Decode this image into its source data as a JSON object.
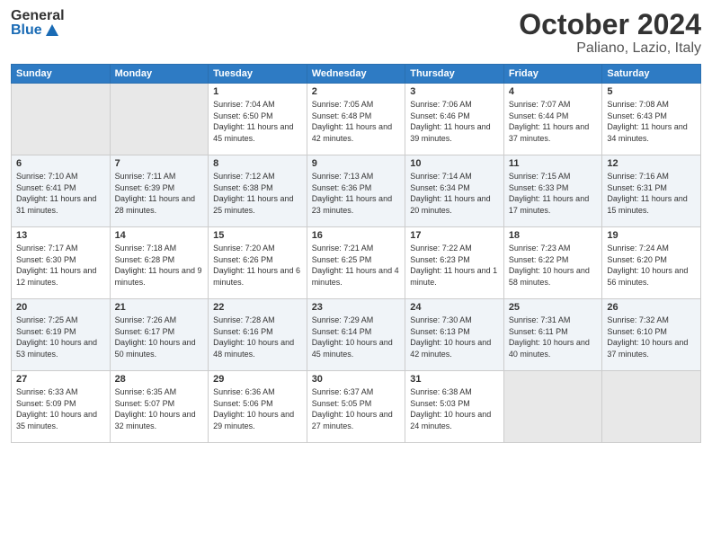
{
  "header": {
    "logo_general": "General",
    "logo_blue": "Blue",
    "month": "October 2024",
    "location": "Paliano, Lazio, Italy"
  },
  "weekdays": [
    "Sunday",
    "Monday",
    "Tuesday",
    "Wednesday",
    "Thursday",
    "Friday",
    "Saturday"
  ],
  "weeks": [
    [
      {
        "day": "",
        "sunrise": "",
        "sunset": "",
        "daylight": ""
      },
      {
        "day": "",
        "sunrise": "",
        "sunset": "",
        "daylight": ""
      },
      {
        "day": "1",
        "sunrise": "Sunrise: 7:04 AM",
        "sunset": "Sunset: 6:50 PM",
        "daylight": "Daylight: 11 hours and 45 minutes."
      },
      {
        "day": "2",
        "sunrise": "Sunrise: 7:05 AM",
        "sunset": "Sunset: 6:48 PM",
        "daylight": "Daylight: 11 hours and 42 minutes."
      },
      {
        "day": "3",
        "sunrise": "Sunrise: 7:06 AM",
        "sunset": "Sunset: 6:46 PM",
        "daylight": "Daylight: 11 hours and 39 minutes."
      },
      {
        "day": "4",
        "sunrise": "Sunrise: 7:07 AM",
        "sunset": "Sunset: 6:44 PM",
        "daylight": "Daylight: 11 hours and 37 minutes."
      },
      {
        "day": "5",
        "sunrise": "Sunrise: 7:08 AM",
        "sunset": "Sunset: 6:43 PM",
        "daylight": "Daylight: 11 hours and 34 minutes."
      }
    ],
    [
      {
        "day": "6",
        "sunrise": "Sunrise: 7:10 AM",
        "sunset": "Sunset: 6:41 PM",
        "daylight": "Daylight: 11 hours and 31 minutes."
      },
      {
        "day": "7",
        "sunrise": "Sunrise: 7:11 AM",
        "sunset": "Sunset: 6:39 PM",
        "daylight": "Daylight: 11 hours and 28 minutes."
      },
      {
        "day": "8",
        "sunrise": "Sunrise: 7:12 AM",
        "sunset": "Sunset: 6:38 PM",
        "daylight": "Daylight: 11 hours and 25 minutes."
      },
      {
        "day": "9",
        "sunrise": "Sunrise: 7:13 AM",
        "sunset": "Sunset: 6:36 PM",
        "daylight": "Daylight: 11 hours and 23 minutes."
      },
      {
        "day": "10",
        "sunrise": "Sunrise: 7:14 AM",
        "sunset": "Sunset: 6:34 PM",
        "daylight": "Daylight: 11 hours and 20 minutes."
      },
      {
        "day": "11",
        "sunrise": "Sunrise: 7:15 AM",
        "sunset": "Sunset: 6:33 PM",
        "daylight": "Daylight: 11 hours and 17 minutes."
      },
      {
        "day": "12",
        "sunrise": "Sunrise: 7:16 AM",
        "sunset": "Sunset: 6:31 PM",
        "daylight": "Daylight: 11 hours and 15 minutes."
      }
    ],
    [
      {
        "day": "13",
        "sunrise": "Sunrise: 7:17 AM",
        "sunset": "Sunset: 6:30 PM",
        "daylight": "Daylight: 11 hours and 12 minutes."
      },
      {
        "day": "14",
        "sunrise": "Sunrise: 7:18 AM",
        "sunset": "Sunset: 6:28 PM",
        "daylight": "Daylight: 11 hours and 9 minutes."
      },
      {
        "day": "15",
        "sunrise": "Sunrise: 7:20 AM",
        "sunset": "Sunset: 6:26 PM",
        "daylight": "Daylight: 11 hours and 6 minutes."
      },
      {
        "day": "16",
        "sunrise": "Sunrise: 7:21 AM",
        "sunset": "Sunset: 6:25 PM",
        "daylight": "Daylight: 11 hours and 4 minutes."
      },
      {
        "day": "17",
        "sunrise": "Sunrise: 7:22 AM",
        "sunset": "Sunset: 6:23 PM",
        "daylight": "Daylight: 11 hours and 1 minute."
      },
      {
        "day": "18",
        "sunrise": "Sunrise: 7:23 AM",
        "sunset": "Sunset: 6:22 PM",
        "daylight": "Daylight: 10 hours and 58 minutes."
      },
      {
        "day": "19",
        "sunrise": "Sunrise: 7:24 AM",
        "sunset": "Sunset: 6:20 PM",
        "daylight": "Daylight: 10 hours and 56 minutes."
      }
    ],
    [
      {
        "day": "20",
        "sunrise": "Sunrise: 7:25 AM",
        "sunset": "Sunset: 6:19 PM",
        "daylight": "Daylight: 10 hours and 53 minutes."
      },
      {
        "day": "21",
        "sunrise": "Sunrise: 7:26 AM",
        "sunset": "Sunset: 6:17 PM",
        "daylight": "Daylight: 10 hours and 50 minutes."
      },
      {
        "day": "22",
        "sunrise": "Sunrise: 7:28 AM",
        "sunset": "Sunset: 6:16 PM",
        "daylight": "Daylight: 10 hours and 48 minutes."
      },
      {
        "day": "23",
        "sunrise": "Sunrise: 7:29 AM",
        "sunset": "Sunset: 6:14 PM",
        "daylight": "Daylight: 10 hours and 45 minutes."
      },
      {
        "day": "24",
        "sunrise": "Sunrise: 7:30 AM",
        "sunset": "Sunset: 6:13 PM",
        "daylight": "Daylight: 10 hours and 42 minutes."
      },
      {
        "day": "25",
        "sunrise": "Sunrise: 7:31 AM",
        "sunset": "Sunset: 6:11 PM",
        "daylight": "Daylight: 10 hours and 40 minutes."
      },
      {
        "day": "26",
        "sunrise": "Sunrise: 7:32 AM",
        "sunset": "Sunset: 6:10 PM",
        "daylight": "Daylight: 10 hours and 37 minutes."
      }
    ],
    [
      {
        "day": "27",
        "sunrise": "Sunrise: 6:33 AM",
        "sunset": "Sunset: 5:09 PM",
        "daylight": "Daylight: 10 hours and 35 minutes."
      },
      {
        "day": "28",
        "sunrise": "Sunrise: 6:35 AM",
        "sunset": "Sunset: 5:07 PM",
        "daylight": "Daylight: 10 hours and 32 minutes."
      },
      {
        "day": "29",
        "sunrise": "Sunrise: 6:36 AM",
        "sunset": "Sunset: 5:06 PM",
        "daylight": "Daylight: 10 hours and 29 minutes."
      },
      {
        "day": "30",
        "sunrise": "Sunrise: 6:37 AM",
        "sunset": "Sunset: 5:05 PM",
        "daylight": "Daylight: 10 hours and 27 minutes."
      },
      {
        "day": "31",
        "sunrise": "Sunrise: 6:38 AM",
        "sunset": "Sunset: 5:03 PM",
        "daylight": "Daylight: 10 hours and 24 minutes."
      },
      {
        "day": "",
        "sunrise": "",
        "sunset": "",
        "daylight": ""
      },
      {
        "day": "",
        "sunrise": "",
        "sunset": "",
        "daylight": ""
      }
    ]
  ]
}
